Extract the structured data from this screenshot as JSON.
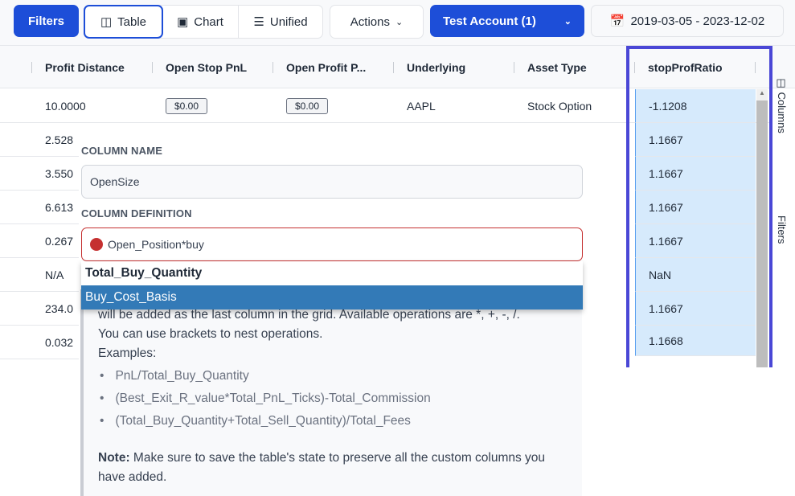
{
  "toolbar": {
    "filters": "Filters",
    "views": [
      {
        "label": "Table",
        "icon": "table-icon"
      },
      {
        "label": "Chart",
        "icon": "image-icon"
      },
      {
        "label": "Unified",
        "icon": "layers-icon"
      }
    ],
    "actions": "Actions",
    "account": "Test Account (1)",
    "date_range": "2019-03-05 - 2023-12-02"
  },
  "columns": [
    "Profit Distance",
    "Open Stop PnL",
    "Open Profit P...",
    "Underlying",
    "Asset Type",
    "stopProfRatio"
  ],
  "first_row": {
    "profit_distance": "10.0000",
    "open_stop_pnl": "$0.00",
    "open_profit": "$0.00",
    "underlying": "AAPL",
    "asset_type": "Stock Option"
  },
  "profit_distance_partial": [
    "2.528",
    "3.550",
    "6.613",
    "0.267",
    "N/A",
    "234.0",
    "0.032"
  ],
  "ratios": [
    "-1.1208",
    "1.1667",
    "1.1667",
    "1.1667",
    "1.1667",
    "NaN",
    "1.1667",
    "1.1668"
  ],
  "side_tabs": {
    "columns": "Columns",
    "filters": "Filters"
  },
  "panel": {
    "name_label": "COLUMN NAME",
    "name_value": "OpenSize",
    "def_label": "COLUMN DEFINITION",
    "def_value": "Open_Position*buy",
    "suggestions": [
      "Total_Buy_Quantity",
      "Buy_Cost_Basis"
    ],
    "help_line1": "will be added as the last column in the grid. Available operations are *, +, -, /.",
    "help_line2": "You can use brackets to nest operations.",
    "examples_label": "Examples:",
    "examples": [
      "PnL/Total_Buy_Quantity",
      "(Best_Exit_R_value*Total_PnL_Ticks)-Total_Commission",
      "(Total_Buy_Quantity+Total_Sell_Quantity)/Total_Fees"
    ],
    "note_label": "Note:",
    "note_text": " Make sure to save the table's state to preserve all the custom columns you have added."
  },
  "colors": {
    "primary": "#1d4ed8",
    "highlight": "#4a47d6",
    "selected_option": "#337ab7",
    "error": "#c53030"
  }
}
